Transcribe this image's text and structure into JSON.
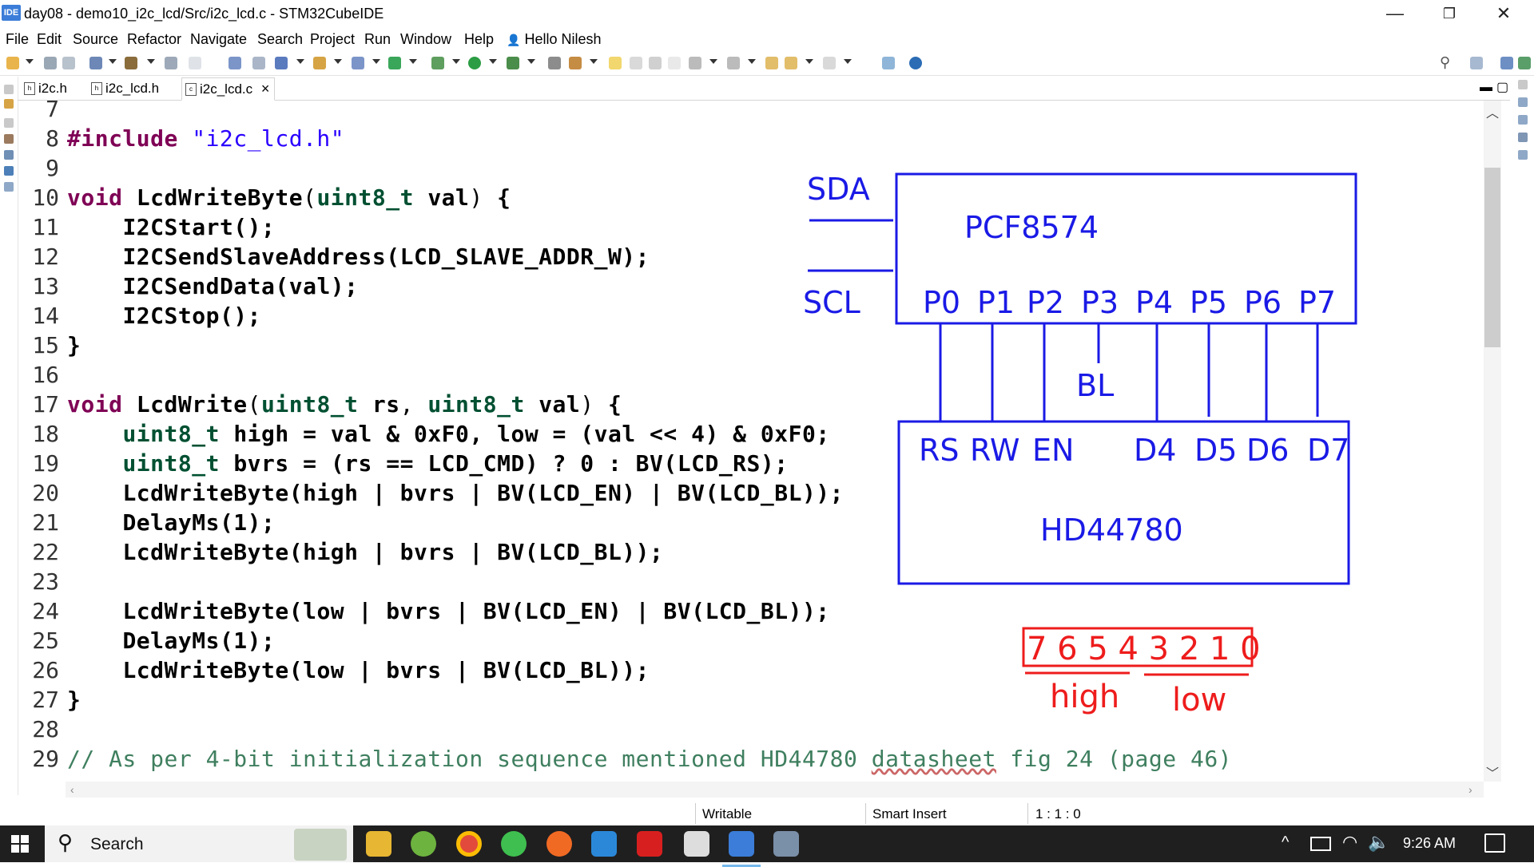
{
  "window": {
    "app_icon_label": "IDE",
    "title": "day08 - demo10_i2c_lcd/Src/i2c_lcd.c - STM32CubeIDE",
    "minimize": "—",
    "restore": "❐",
    "close": "✕"
  },
  "menu": [
    "File",
    "Edit",
    "Source",
    "Refactor",
    "Navigate",
    "Search",
    "Project",
    "Run",
    "Window",
    "Help"
  ],
  "user": "Hello Nilesh",
  "tabs": [
    {
      "label": "i2c.h",
      "active": false
    },
    {
      "label": "i2c_lcd.h",
      "active": false
    },
    {
      "label": "i2c_lcd.c",
      "active": true,
      "close": "×"
    }
  ],
  "code_lines": [
    {
      "n": "7",
      "html": ""
    },
    {
      "n": "8",
      "html": "<span class=\"pp\">#include</span> <span class=\"str\">\"i2c_lcd.h\"</span>"
    },
    {
      "n": "9",
      "html": ""
    },
    {
      "n": "10",
      "html": "<span class=\"kw\">void</span> <b>LcdWriteByte</b>(<span class=\"ty\">uint8_t</span> <b>val</b>) <b>{</b>"
    },
    {
      "n": "11",
      "html": "    <b>I2CStart();</b>"
    },
    {
      "n": "12",
      "html": "    <b>I2CSendSlaveAddress(LCD_SLAVE_ADDR_W);</b>"
    },
    {
      "n": "13",
      "html": "    <b>I2CSendData(val);</b>"
    },
    {
      "n": "14",
      "html": "    <b>I2CStop();</b>"
    },
    {
      "n": "15",
      "html": "<b>}</b>"
    },
    {
      "n": "16",
      "html": ""
    },
    {
      "n": "17",
      "html": "<span class=\"kw\">void</span> <b>LcdWrite</b>(<span class=\"ty\">uint8_t</span> <b>rs</b>, <span class=\"ty\">uint8_t</span> <b>val</b>) <b>{</b>"
    },
    {
      "n": "18",
      "html": "    <span class=\"ty\">uint8_t</span> <b>high = val &amp; 0xF0, low = (val &lt;&lt; 4) &amp; 0xF0;</b>"
    },
    {
      "n": "19",
      "html": "    <span class=\"ty\">uint8_t</span> <b>bvrs = (rs == LCD_CMD) ? 0 : BV(LCD_RS);</b>"
    },
    {
      "n": "20",
      "html": "    <b>LcdWriteByte(high | bvrs | BV(LCD_EN) | BV(LCD_BL));</b>"
    },
    {
      "n": "21",
      "html": "    <b>DelayMs(1);</b>"
    },
    {
      "n": "22",
      "html": "    <b>LcdWriteByte(high | bvrs | BV(LCD_BL));</b>"
    },
    {
      "n": "23",
      "html": ""
    },
    {
      "n": "24",
      "html": "    <b>LcdWriteByte(low | bvrs | BV(LCD_EN) | BV(LCD_BL));</b>"
    },
    {
      "n": "25",
      "html": "    <b>DelayMs(1);</b>"
    },
    {
      "n": "26",
      "html": "    <b>LcdWriteByte(low | bvrs | BV(LCD_BL));</b>"
    },
    {
      "n": "27",
      "html": "<b>}</b>"
    },
    {
      "n": "28",
      "html": ""
    },
    {
      "n": "29",
      "html": "<span class=\"cm\">// As per 4-bit initialization sequence mentioned HD44780 <u style=\"text-decoration-style:wavy;text-decoration-color:#c66\">datasheet</u> fig 24 (page 46)</span>"
    }
  ],
  "annotation": {
    "sda": "SDA",
    "scl": "SCL",
    "pcf_label": "PCF8574",
    "pcf_pins": [
      "P0",
      "P1",
      "P2",
      "P3",
      "P4",
      "P5",
      "P6",
      "P7"
    ],
    "bl_label": "BL",
    "hd_pins": [
      "RS",
      "RW",
      "EN",
      "D4",
      "D5",
      "D6",
      "D7"
    ],
    "hd_label": "HD44780",
    "bits": "7 6 5 4 3 2 1 0",
    "high": "high",
    "low": "low",
    "blue": "#1a1ae6",
    "red": "#ee1c1c"
  },
  "status": {
    "writable": "Writable",
    "insert": "Smart Insert",
    "position": "1 : 1 : 0"
  },
  "taskbar": {
    "search": "Search",
    "time": "9:26 AM"
  }
}
